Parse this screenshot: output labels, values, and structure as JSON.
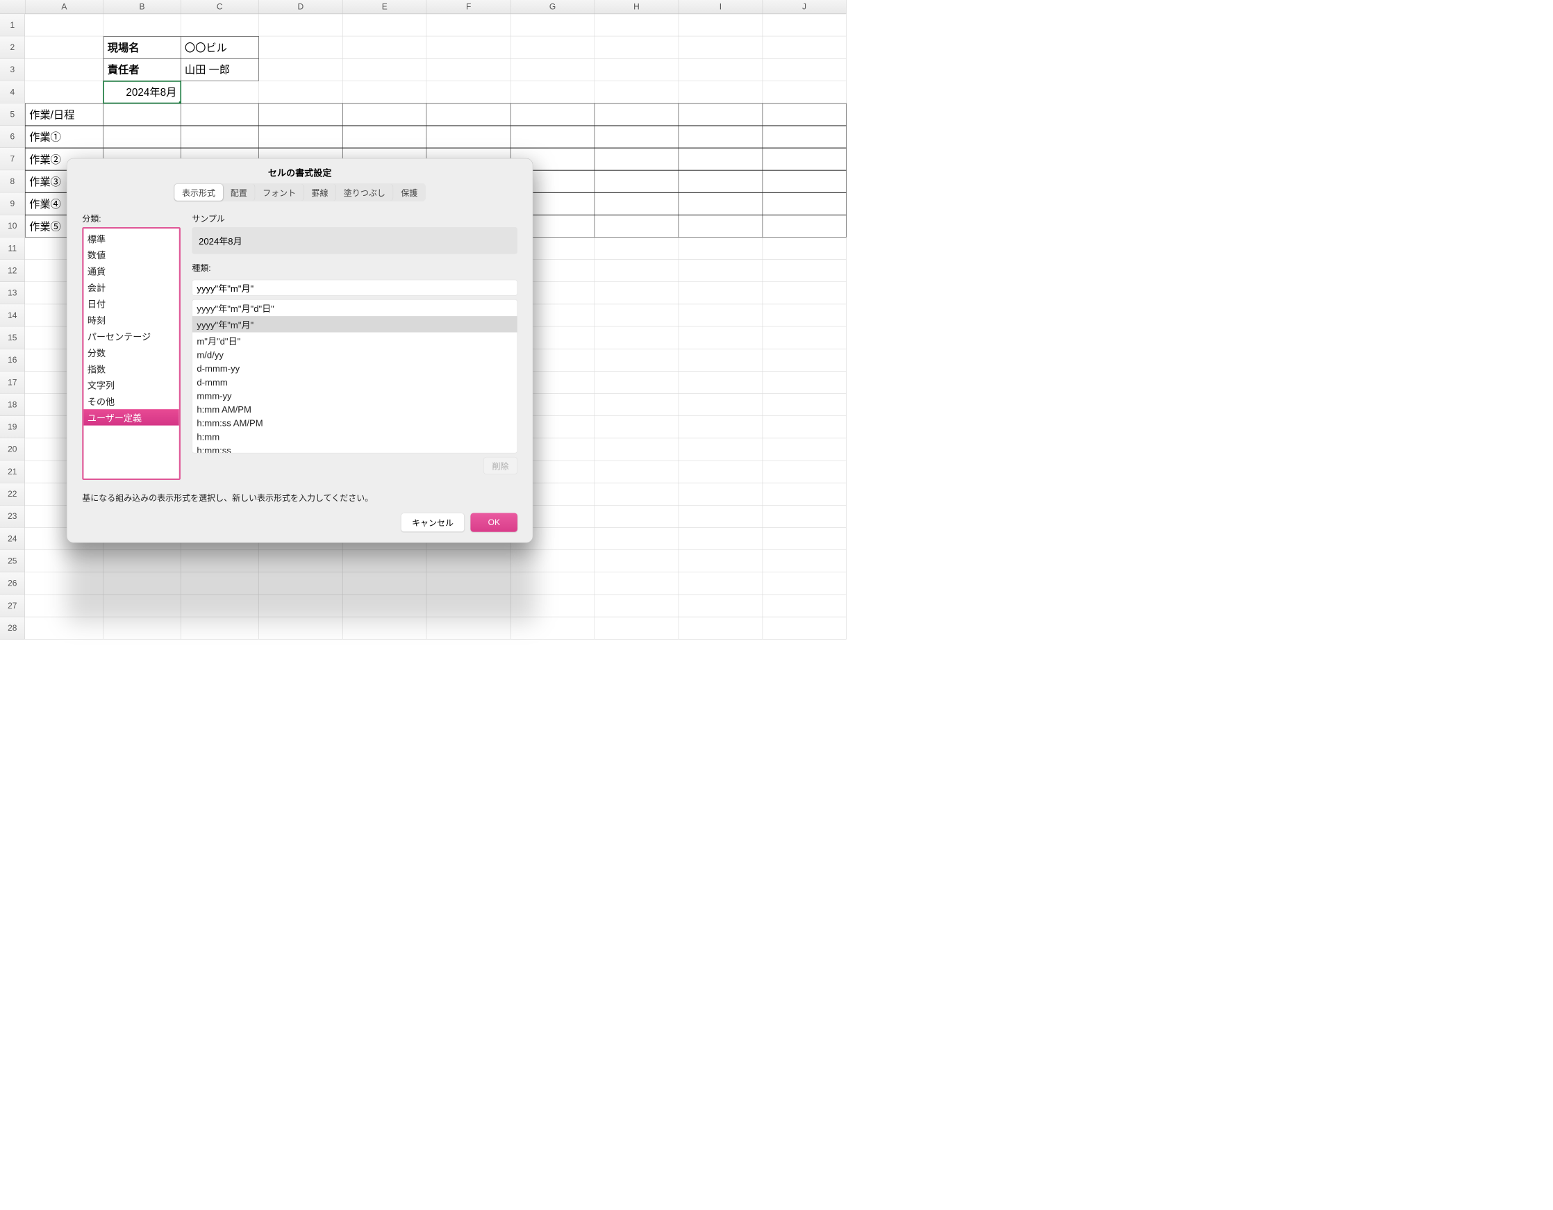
{
  "grid": {
    "columns": [
      "A",
      "B",
      "C",
      "D",
      "E",
      "F",
      "G",
      "H",
      "I",
      "J"
    ],
    "rows": 28,
    "cells": {
      "B2": "現場名",
      "C2": "〇〇ビル",
      "B3": "責任者",
      "C3": "山田 一郎",
      "B4": "2024年8月",
      "A5": "作業/日程",
      "A6": "作業①",
      "A7": "作業②",
      "A8": "作業③",
      "A9": "作業④",
      "A10": "作業⑤"
    },
    "active_cell": "B4"
  },
  "dialog": {
    "title": "セルの書式設定",
    "tabs": [
      "表示形式",
      "配置",
      "フォント",
      "罫線",
      "塗りつぶし",
      "保護"
    ],
    "active_tab": 0,
    "category": {
      "label": "分類:",
      "items": [
        "標準",
        "数値",
        "通貨",
        "会計",
        "日付",
        "時刻",
        "パーセンテージ",
        "分数",
        "指数",
        "文字列",
        "その他",
        "ユーザー定義"
      ],
      "selected": 11
    },
    "sample": {
      "label": "サンプル",
      "value": "2024年8月"
    },
    "type": {
      "label": "種類:",
      "input": "yyyy\"年\"m\"月\"",
      "list": [
        "yyyy\"年\"m\"月\"d\"日\"",
        "yyyy\"年\"m\"月\"",
        "m\"月\"d\"日\"",
        "m/d/yy",
        "d-mmm-yy",
        "d-mmm",
        "mmm-yy",
        "h:mm AM/PM",
        "h:mm:ss AM/PM",
        "h:mm",
        "h:mm:ss"
      ],
      "selected": 1,
      "delete_label": "削除"
    },
    "hint": "基になる組み込みの表示形式を選択し、新しい表示形式を入力してください。",
    "ok_label": "OK",
    "cancel_label": "キャンセル"
  }
}
